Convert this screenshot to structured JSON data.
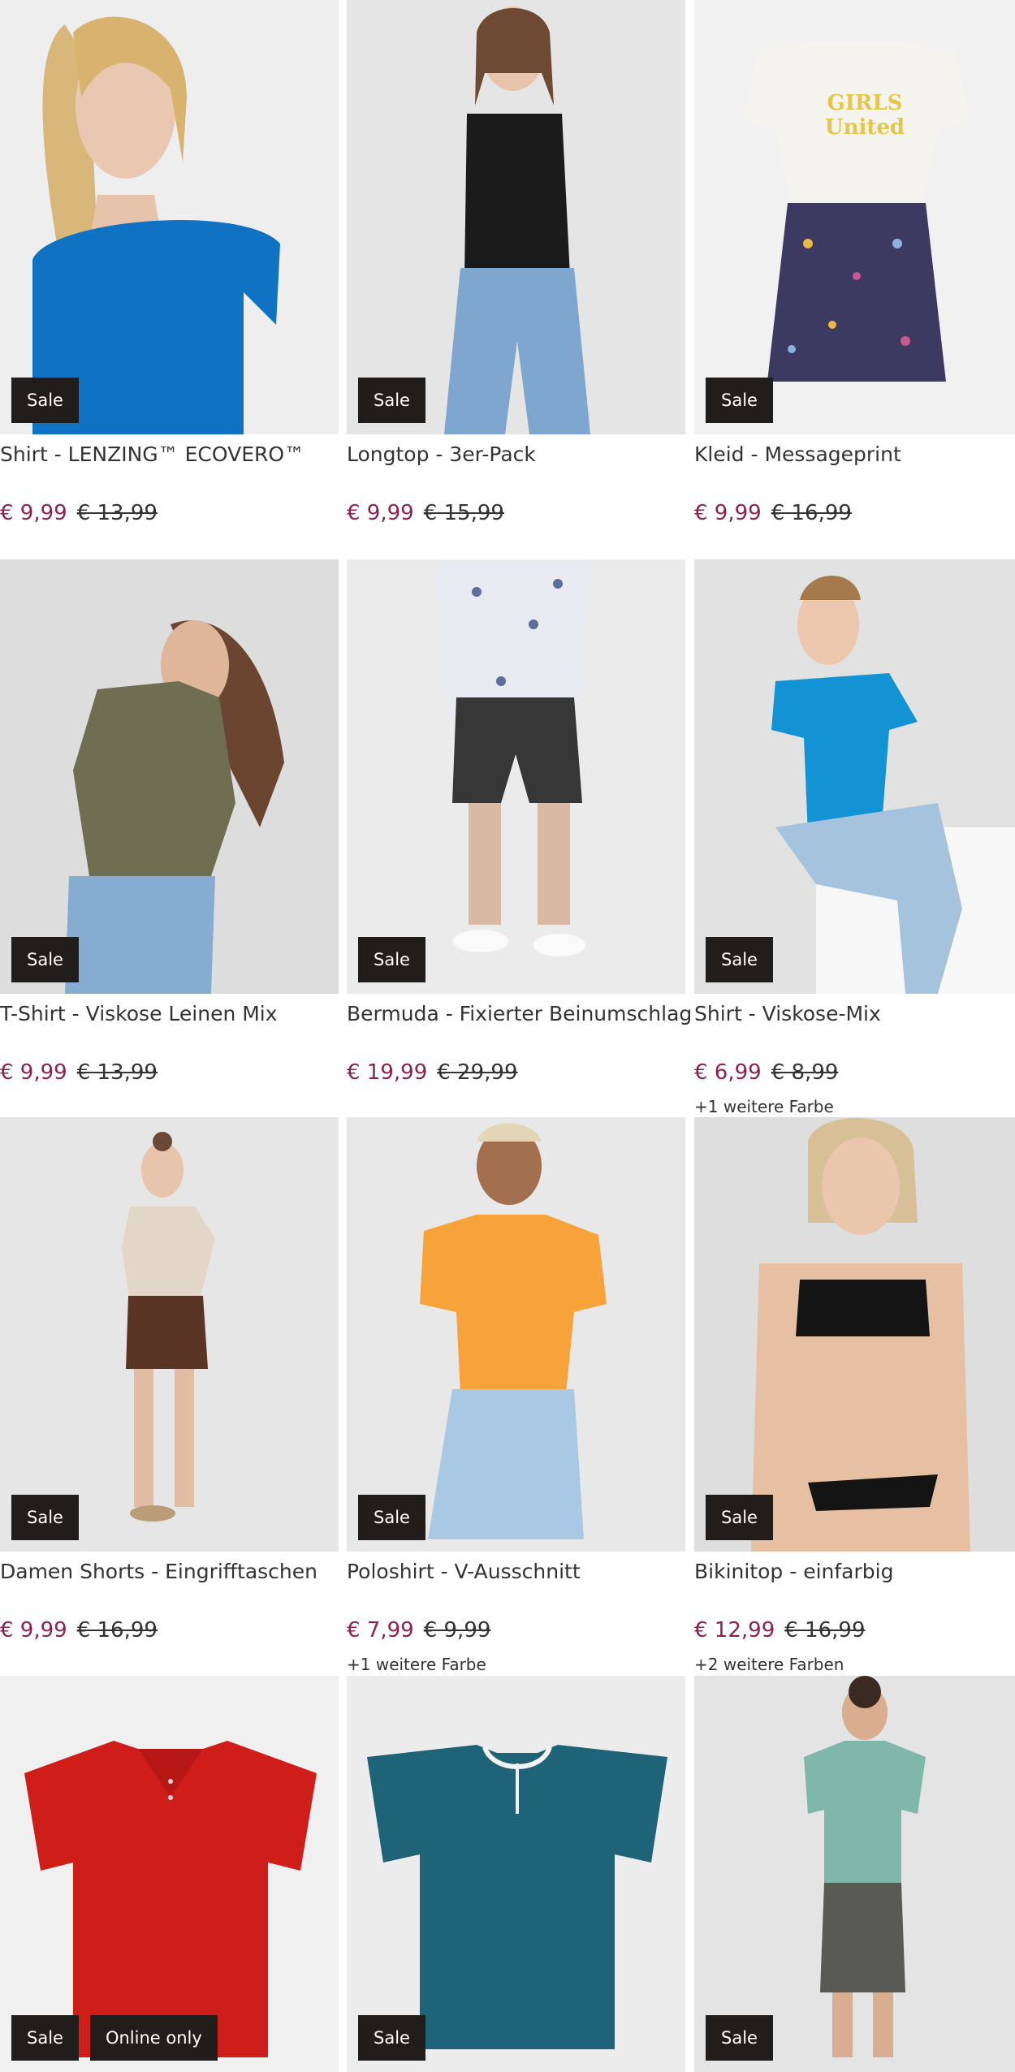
{
  "products": [
    {
      "name": "Shirt - LENZING™ ECOVERO™",
      "price": "€ 9,99",
      "old_price": "€ 13,99",
      "badge_sale": "Sale"
    },
    {
      "name": "Longtop - 3er-Pack",
      "price": "€ 9,99",
      "old_price": "€ 15,99",
      "badge_sale": "Sale"
    },
    {
      "name": "Kleid - Messageprint",
      "price": "€ 9,99",
      "old_price": "€ 16,99",
      "badge_sale": "Sale",
      "print_text": "GIRLS United"
    },
    {
      "name": "T-Shirt - Viskose Leinen Mix",
      "price": "€ 9,99",
      "old_price": "€ 13,99",
      "badge_sale": "Sale"
    },
    {
      "name": "Bermuda - Fixierter Beinumschlag",
      "price": "€ 19,99",
      "old_price": "€ 29,99",
      "badge_sale": "Sale"
    },
    {
      "name": "Shirt - Viskose-Mix",
      "price": "€ 6,99",
      "old_price": "€ 8,99",
      "badge_sale": "Sale",
      "more_colors": "+1 weitere Farbe"
    },
    {
      "name": "Damen Shorts - Eingrifftaschen",
      "price": "€ 9,99",
      "old_price": "€ 16,99",
      "badge_sale": "Sale"
    },
    {
      "name": "Poloshirt - V-Ausschnitt",
      "price": "€ 7,99",
      "old_price": "€ 9,99",
      "badge_sale": "Sale",
      "more_colors": "+1 weitere Farbe"
    },
    {
      "name": "Bikinitop - einfarbig",
      "price": "€ 12,99",
      "old_price": "€ 16,99",
      "badge_sale": "Sale",
      "more_colors": "+2 weitere Farben"
    },
    {
      "badge_sale": "Sale",
      "badge_online": "Online only"
    },
    {
      "badge_sale": "Sale"
    },
    {
      "badge_sale": "Sale"
    }
  ],
  "colors": {
    "price_sale": "#8d2150",
    "badge_bg": "#211d1b",
    "image_bg": "#ebebeb"
  }
}
